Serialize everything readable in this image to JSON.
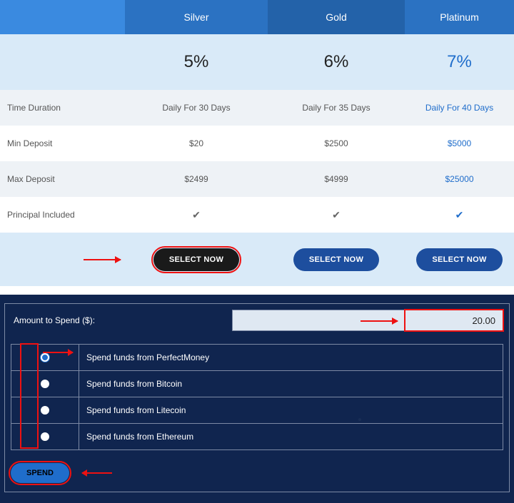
{
  "pricing": {
    "plans": [
      "Silver",
      "Gold",
      "Platinum"
    ],
    "percent": [
      "5%",
      "6%",
      "7%"
    ],
    "rows": {
      "duration": {
        "label": "Time Duration",
        "values": [
          "Daily For 30 Days",
          "Daily For 35 Days",
          "Daily For 40 Days"
        ]
      },
      "min": {
        "label": "Min Deposit",
        "values": [
          "$20",
          "$2500",
          "$5000"
        ]
      },
      "max": {
        "label": "Max Deposit",
        "values": [
          "$2499",
          "$4999",
          "$25000"
        ]
      },
      "principal": {
        "label": "Principal Included"
      }
    },
    "select_label": "SELECT NOW"
  },
  "spend": {
    "amount_label": "Amount to Spend ($):",
    "amount_value": "20.00",
    "methods": [
      "Spend funds from PerfectMoney",
      "Spend funds from Bitcoin",
      "Spend funds from Litecoin",
      "Spend funds from Ethereum"
    ],
    "button": "SPEND"
  }
}
